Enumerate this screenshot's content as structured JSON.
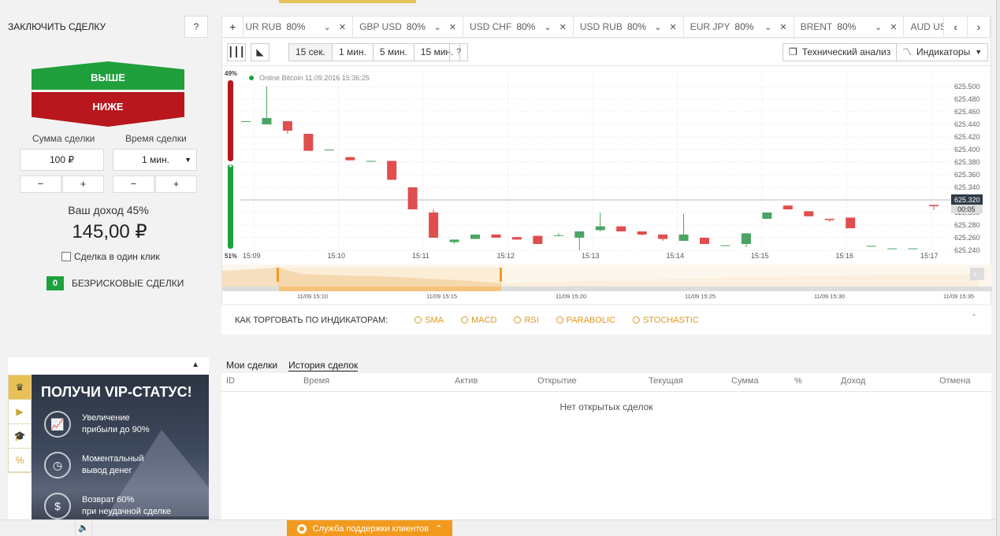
{
  "left": {
    "heading": "ЗАКЛЮЧИТЬ СДЕЛКУ",
    "help": "?",
    "btn_up": "ВЫШЕ",
    "btn_down": "НИЖЕ",
    "amount_label": "Сумма сделки",
    "time_label": "Время сделки",
    "amount_value": "100 ₽",
    "time_value": "1 мин.",
    "minus": "−",
    "plus": "+",
    "income_label": "Ваш доход 45%",
    "income_value": "145,00 ₽",
    "one_click": "Сделка в один клик",
    "riskfree_count": "0",
    "riskfree_label": "БЕЗРИСКОВЫЕ СДЕЛКИ"
  },
  "vip": {
    "title": "ПОЛУЧИ VIP-СТАТУС!",
    "tabs": [
      "♛",
      "▶",
      "🎓",
      "%"
    ],
    "items": [
      {
        "icon": "growth-chart-icon",
        "glyph": "📈",
        "line1": "Увеличение",
        "line2": "прибыли до 90%"
      },
      {
        "icon": "clock-icon",
        "glyph": "◷",
        "line1": "Моментальный",
        "line2": "вывод денег"
      },
      {
        "icon": "dollar-icon",
        "glyph": "$",
        "line1": "Возврат 60%",
        "line2": "при неудачной сделке"
      }
    ]
  },
  "tabs": {
    "plus": "+",
    "items": [
      {
        "pair": "UR RUB",
        "pct": "80%"
      },
      {
        "pair": "GBP USD",
        "pct": "80%"
      },
      {
        "pair": "USD CHF",
        "pct": "80%"
      },
      {
        "pair": "USD RUB",
        "pct": "80%"
      },
      {
        "pair": "EUR JPY",
        "pct": "80%"
      },
      {
        "pair": "BRENT",
        "pct": "80%"
      },
      {
        "pair": "AUD US",
        "pct": ""
      }
    ],
    "prev": "‹",
    "next": "›"
  },
  "toolbar": {
    "timeframes": [
      "15 сек.",
      "1 мин.",
      "5 мин.",
      "15 мин."
    ],
    "help": "?",
    "tech": "Технический анализ",
    "indicators": "Индикаторы"
  },
  "chart_data": {
    "type": "candlestick",
    "title": "Online Bitcoin 11.09.2016 15:36:25",
    "up_pct": "49%",
    "down_pct": "51%",
    "ylim": [
      625.23,
      625.52
    ],
    "yticks": [
      625.5,
      625.48,
      625.46,
      625.44,
      625.42,
      625.4,
      625.38,
      625.36,
      625.34,
      625.32,
      625.3,
      625.28,
      625.26,
      625.24
    ],
    "ytick_labels": [
      "625.500",
      "625.480",
      "625.460",
      "625.440",
      "625.420",
      "625.400",
      "625.380",
      "625.360",
      "625.340",
      "625.320",
      "625.300",
      "625.280",
      "625.260",
      "625.240"
    ],
    "current_price": "625.320",
    "current_value": 625.32,
    "countdown": "00:05",
    "xticks": [
      "15:09",
      "15:10",
      "15:11",
      "15:12",
      "15:13",
      "15:14",
      "15:15",
      "15:16",
      "15:17"
    ],
    "candles": [
      {
        "o": 625.445,
        "c": 625.445,
        "h": 625.445,
        "l": 625.445
      },
      {
        "o": 625.44,
        "c": 625.45,
        "h": 625.5,
        "l": 625.44
      },
      {
        "o": 625.445,
        "c": 625.43,
        "h": 625.445,
        "l": 625.425
      },
      {
        "o": 625.425,
        "c": 625.398,
        "h": 625.425,
        "l": 625.398
      },
      {
        "o": 625.4,
        "c": 625.4,
        "h": 625.4,
        "l": 625.4
      },
      {
        "o": 625.388,
        "c": 625.383,
        "h": 625.388,
        "l": 625.383
      },
      {
        "o": 625.382,
        "c": 625.382,
        "h": 625.382,
        "l": 625.382
      },
      {
        "o": 625.382,
        "c": 625.352,
        "h": 625.382,
        "l": 625.352
      },
      {
        "o": 625.34,
        "c": 625.305,
        "h": 625.34,
        "l": 625.305
      },
      {
        "o": 625.3,
        "c": 625.26,
        "h": 625.305,
        "l": 625.26
      },
      {
        "o": 625.253,
        "c": 625.257,
        "h": 625.257,
        "l": 625.25
      },
      {
        "o": 625.258,
        "c": 625.265,
        "h": 625.265,
        "l": 625.258
      },
      {
        "o": 625.265,
        "c": 625.26,
        "h": 625.265,
        "l": 625.26
      },
      {
        "o": 625.261,
        "c": 625.257,
        "h": 625.261,
        "l": 625.257
      },
      {
        "o": 625.263,
        "c": 625.25,
        "h": 625.263,
        "l": 625.25
      },
      {
        "o": 625.264,
        "c": 625.264,
        "h": 625.267,
        "l": 625.262
      },
      {
        "o": 625.26,
        "c": 625.27,
        "h": 625.27,
        "l": 625.24
      },
      {
        "o": 625.272,
        "c": 625.278,
        "h": 625.3,
        "l": 625.27
      },
      {
        "o": 625.278,
        "c": 625.27,
        "h": 625.278,
        "l": 625.27
      },
      {
        "o": 625.27,
        "c": 625.265,
        "h": 625.27,
        "l": 625.263
      },
      {
        "o": 625.265,
        "c": 625.258,
        "h": 625.265,
        "l": 625.255
      },
      {
        "o": 625.255,
        "c": 625.265,
        "h": 625.298,
        "l": 625.255
      },
      {
        "o": 625.26,
        "c": 625.25,
        "h": 625.26,
        "l": 625.25
      },
      {
        "o": 625.248,
        "c": 625.248,
        "h": 625.248,
        "l": 625.248
      },
      {
        "o": 625.25,
        "c": 625.267,
        "h": 625.267,
        "l": 625.245
      },
      {
        "o": 625.29,
        "c": 625.3,
        "h": 625.3,
        "l": 625.29
      },
      {
        "o": 625.311,
        "c": 625.305,
        "h": 625.311,
        "l": 625.305
      },
      {
        "o": 625.302,
        "c": 625.294,
        "h": 625.302,
        "l": 625.294
      },
      {
        "o": 625.29,
        "c": 625.288,
        "h": 625.29,
        "l": 625.285
      },
      {
        "o": 625.292,
        "c": 625.275,
        "h": 625.292,
        "l": 625.275
      },
      {
        "o": 625.247,
        "c": 625.247,
        "h": 625.247,
        "l": 625.247
      },
      {
        "o": 625.243,
        "c": 625.243,
        "h": 625.243,
        "l": 625.243
      },
      {
        "o": 625.242,
        "c": 625.243,
        "h": 625.243,
        "l": 625.242
      },
      {
        "o": 625.312,
        "c": 625.31,
        "h": 625.312,
        "l": 625.304
      }
    ]
  },
  "navigator": {
    "labels": [
      "11/09 15:10",
      "11/09 15:15",
      "11/09 15:20",
      "11/09 15:25",
      "11/09 15:30",
      "11/09 15:35"
    ]
  },
  "howto": {
    "label": "КАК ТОРГОВАТЬ ПО ИНДИКАТОРАМ:",
    "indicators": [
      "SMA",
      "MACD",
      "RSI",
      "PARABOLIC",
      "STOCHASTIC"
    ]
  },
  "deals": {
    "tabs": [
      "Мои сделки",
      "История сделок"
    ],
    "columns": [
      "ID",
      "Время",
      "Актив",
      "Открытие",
      "Текущая",
      "Сумма",
      "%",
      "Доход",
      "Отмена"
    ],
    "empty": "Нет открытых сделок"
  },
  "bottom": {
    "support": "Служба поддержки клиентов"
  },
  "colors": {
    "up": "#1fa03d",
    "down": "#b7171d",
    "candle_up": "#4aa564",
    "candle_down": "#e04e4e",
    "accent": "#f29a1d"
  }
}
